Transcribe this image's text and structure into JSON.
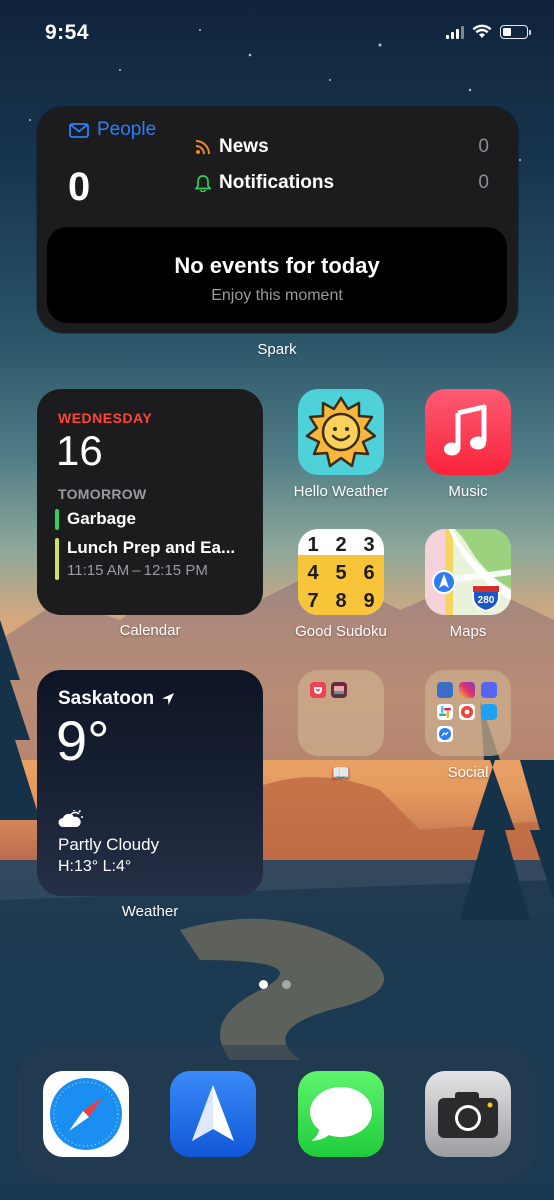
{
  "status_bar": {
    "time": "9:54"
  },
  "spark_widget": {
    "people_label": "People",
    "people_count": "0",
    "news_label": "News",
    "news_count": "0",
    "notifications_label": "Notifications",
    "notifications_count": "0",
    "events_title": "No events for today",
    "events_subtitle": "Enjoy this moment",
    "widget_name": "Spark",
    "accent_color": "#2d7ff9"
  },
  "calendar_widget": {
    "weekday": "WEDNESDAY",
    "date": "16",
    "section": "TOMORROW",
    "events": [
      {
        "title": "Garbage",
        "time": "",
        "color": "#30d158"
      },
      {
        "title": "Lunch Prep and Ea...",
        "time": "11:15 AM – 12:15 PM",
        "color": "#c8e65a"
      }
    ],
    "widget_name": "Calendar"
  },
  "apps": {
    "hello_weather": "Hello Weather",
    "music": "Music",
    "good_sudoku": "Good Sudoku",
    "maps": "Maps",
    "books_folder": "📖",
    "social_folder": "Social"
  },
  "sudoku_digits": [
    "1",
    "2",
    "3",
    "4",
    "5",
    "6",
    "7",
    "8",
    "9"
  ],
  "maps_shield": "280",
  "weather_widget": {
    "city": "Saskatoon",
    "temperature": "9°",
    "condition": "Partly Cloudy",
    "high_low": "H:13° L:4°",
    "widget_name": "Weather"
  },
  "page_indicator": {
    "pages": 2,
    "current": 1
  },
  "dock": [
    "Safari",
    "Spark",
    "Messages",
    "Camera"
  ]
}
